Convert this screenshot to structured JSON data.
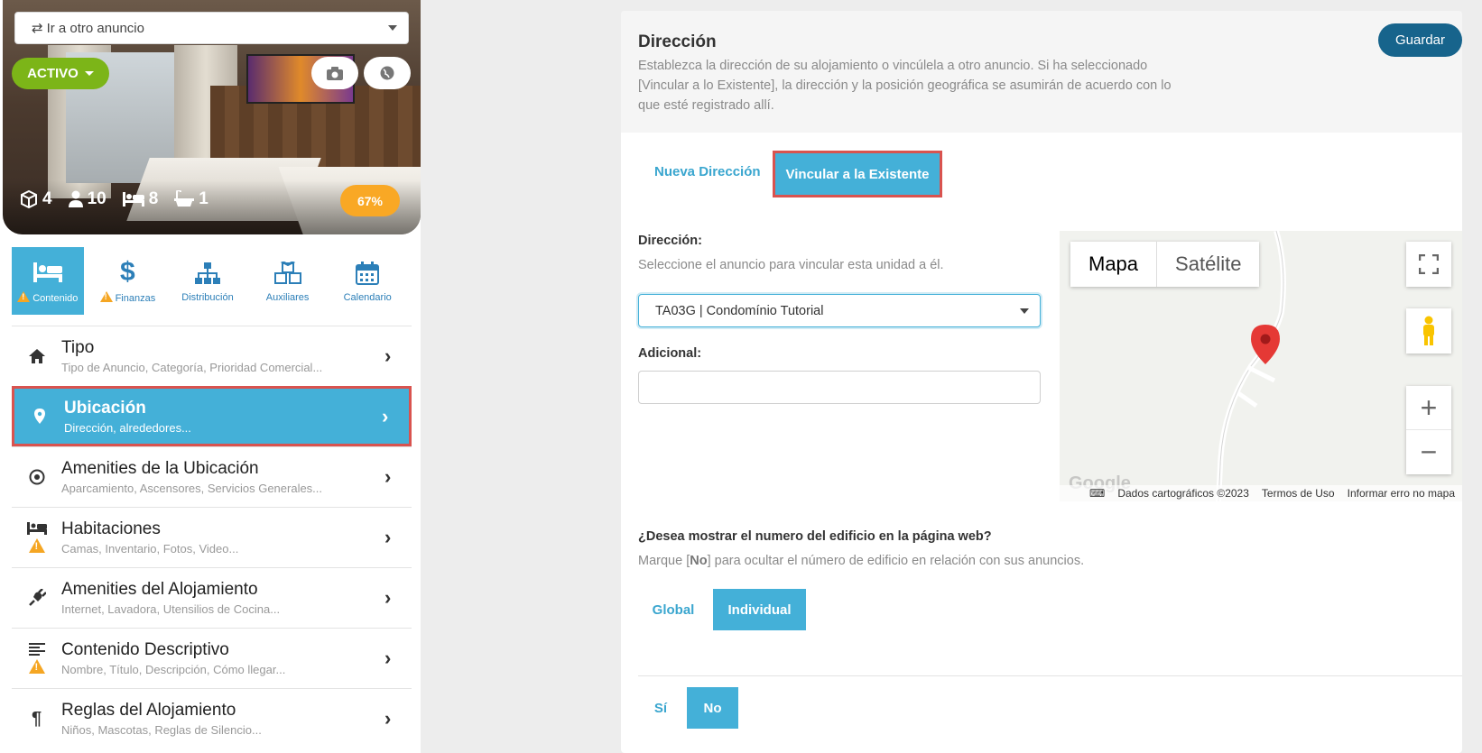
{
  "listing": {
    "goto_label": "Ir a otro anuncio",
    "status": "ACTIVO",
    "stats": {
      "units": "4",
      "guests": "10",
      "beds": "8",
      "baths": "1"
    },
    "completion": "67%"
  },
  "categories": [
    {
      "label": "Contenido",
      "icon": "bed-icon",
      "warning": true,
      "active": true
    },
    {
      "label": "Finanzas",
      "icon": "dollar-icon",
      "warning": true,
      "active": false
    },
    {
      "label": "Distribución",
      "icon": "sitemap-icon",
      "warning": false,
      "active": false
    },
    {
      "label": "Auxiliares",
      "icon": "cubes-icon",
      "warning": false,
      "active": false
    },
    {
      "label": "Calendario",
      "icon": "calendar-icon",
      "warning": false,
      "active": false
    }
  ],
  "menu": [
    {
      "title": "Tipo",
      "subtitle": "Tipo de Anuncio, Categoría, Prioridad Comercial...",
      "icon": "home-icon",
      "warning": false,
      "active": false
    },
    {
      "title": "Ubicación",
      "subtitle": "Dirección, alrededores...",
      "icon": "map-pin-icon",
      "warning": false,
      "active": true
    },
    {
      "title": "Amenities de la Ubicación",
      "subtitle": "Aparcamiento, Ascensores, Servicios Generales...",
      "icon": "target-icon",
      "warning": false,
      "active": false
    },
    {
      "title": "Habitaciones",
      "subtitle": "Camas, Inventario, Fotos, Video...",
      "icon": "bed-icon",
      "warning": true,
      "active": false
    },
    {
      "title": "Amenities del Alojamiento",
      "subtitle": "Internet, Lavadora, Utensilios de Cocina...",
      "icon": "plug-icon",
      "warning": false,
      "active": false
    },
    {
      "title": "Contenido Descriptivo",
      "subtitle": "Nombre, Título, Descripción, Cómo llegar...",
      "icon": "align-left-icon",
      "warning": true,
      "active": false
    },
    {
      "title": "Reglas del Alojamiento",
      "subtitle": "Niños, Mascotas, Reglas de Silencio...",
      "icon": "paragraph-icon",
      "warning": false,
      "active": false
    }
  ],
  "panel": {
    "title": "Dirección",
    "description": "Establezca la dirección de su alojamiento o vincúlela a otro anuncio. Si ha seleccionado [Vincular a lo Existente], la dirección y la posición geográfica se asumirán de acuerdo con lo que esté registrado allí.",
    "save_label": "Guardar",
    "tabs": {
      "new": "Nueva Dirección",
      "link": "Vincular a la Existente"
    },
    "address_label": "Dirección:",
    "address_hint": "Seleccione el anuncio para vincular esta unidad a él.",
    "address_value": "TA03G | Condomínio Tutorial",
    "additional_label": "Adicional:",
    "additional_value": "",
    "building_q": "¿Desea mostrar el numero del edificio en la página web?",
    "building_hint_pre": "Marque [",
    "building_hint_no": "No",
    "building_hint_post": "] para ocultar el número de edificio en relación con sus anuncios.",
    "scope_global": "Global",
    "scope_individual": "Individual",
    "yes": "Sí",
    "no": "No"
  },
  "map": {
    "type_map": "Mapa",
    "type_satellite": "Satélite",
    "attribution": "Dados cartográficos ©2023",
    "terms": "Termos de Uso",
    "report": "Informar erro no mapa",
    "logo": "Google",
    "marker_color": "#e53935"
  },
  "colors": {
    "accent": "#44b0d8",
    "primary_dark": "#17648c",
    "active_green": "#7cb518",
    "badge_orange": "#f9a825",
    "highlight_red": "#d9534f"
  }
}
